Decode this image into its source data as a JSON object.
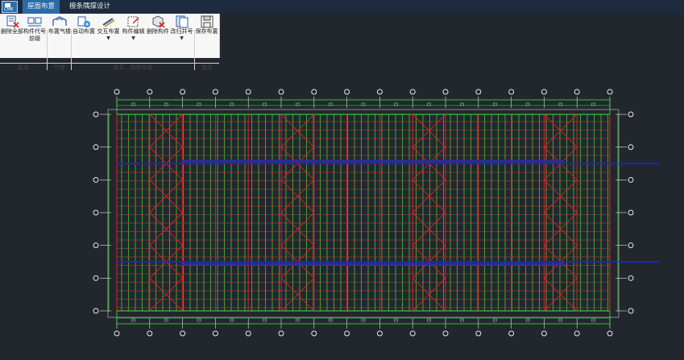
{
  "tabs": [
    {
      "label": "屋面布置",
      "active": true
    },
    {
      "label": "檩条隅撑设计",
      "active": false
    }
  ],
  "app_logo_text": "CMB",
  "ribbon": {
    "buttons": [
      {
        "label": "删除全部",
        "icon": "delete-all-icon"
      },
      {
        "label": "构件代号",
        "label2": "前缀",
        "icon": "member-code-icon"
      },
      {
        "label": "布置气楼",
        "icon": "skylight-icon"
      },
      {
        "label": "自动布置",
        "icon": "auto-layout-icon"
      },
      {
        "label": "交互布置",
        "icon": "interactive-layout-icon",
        "dropdown": true
      },
      {
        "label": "构件编辑",
        "icon": "edit-member-icon",
        "dropdown": true
      },
      {
        "label": "删除构件",
        "icon": "delete-member-icon"
      },
      {
        "label": "改归并号",
        "icon": "merge-number-icon",
        "dropdown": true
      },
      {
        "label": "保存布置",
        "icon": "save-layout-icon"
      }
    ],
    "groups": [
      "基本",
      "气楼",
      "檩条、隅撑布置",
      "整体"
    ]
  },
  "colors": {
    "canvas_bg": "#22272e",
    "purlin_green": "#3de03d",
    "brace_red": "#e02020",
    "beam_blue": "#1c23c8",
    "axis_white": "#e8e8e8"
  }
}
